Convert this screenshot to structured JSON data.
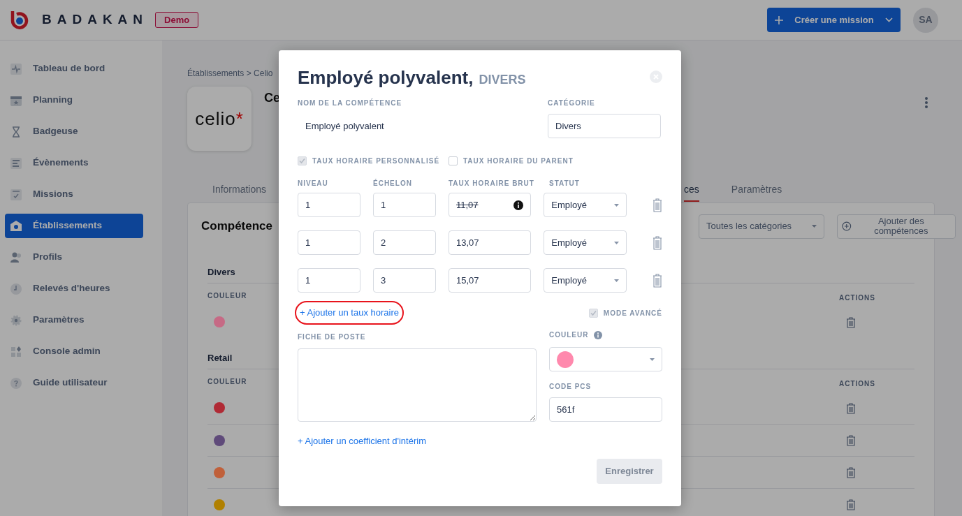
{
  "header": {
    "brand": "BADAKAN",
    "badge": "Demo",
    "create_button": "Créer une mission",
    "avatar": "SA"
  },
  "sidebar": {
    "items": [
      {
        "label": "Tableau de bord",
        "selected": false
      },
      {
        "label": "Planning",
        "selected": false
      },
      {
        "label": "Badgeuse",
        "selected": false
      },
      {
        "label": "Évènements",
        "selected": false
      },
      {
        "label": "Missions",
        "selected": false
      },
      {
        "label": "Établissements",
        "selected": true
      },
      {
        "label": "Profils",
        "selected": false
      },
      {
        "label": "Relevés d'heures",
        "selected": false
      },
      {
        "label": "Paramètres",
        "selected": false
      },
      {
        "label": "Console admin",
        "selected": false
      },
      {
        "label": "Guide utilisateur",
        "selected": false
      }
    ]
  },
  "page": {
    "breadcrumb": "Établissements > Celio",
    "logo": {
      "text": "celio",
      "mark": "*"
    },
    "title": "Ce",
    "tabs": [
      {
        "label": "Informations",
        "selected": false
      },
      {
        "label": "ces",
        "selected": true
      },
      {
        "label": "Paramètres",
        "selected": false
      }
    ],
    "card": {
      "title": "Compétence",
      "filter": "Toutes les catégories",
      "add_button": "Ajouter des compétences",
      "groups": [
        {
          "name": "Divers",
          "color_header": "COULEUR",
          "actions_header": "ACTIONS",
          "rows": [
            {
              "color": "#c66a85"
            }
          ]
        },
        {
          "name": "Retail",
          "color_header": "COULEUR",
          "actions_header": "ACTIONS",
          "rows": [
            {
              "color": "#b02a35"
            },
            {
              "color": "#5f4a7a"
            },
            {
              "color": "#c0603a"
            },
            {
              "color": "#b08000"
            }
          ]
        }
      ]
    }
  },
  "modal": {
    "title": "Employé polyvalent,",
    "subtitle": "DIVERS",
    "name_label": "NOM DE LA COMPÉTENCE",
    "name_value": "Employé polyvalent",
    "category_label": "CATÉGORIE",
    "category_value": "Divers",
    "checks": [
      {
        "label": "TAUX HORAIRE PERSONNALISÉ",
        "checked": true,
        "disabled": true
      },
      {
        "label": "TAUX HORAIRE DU PARENT",
        "checked": false,
        "disabled": false
      }
    ],
    "rate_columns": [
      "NIVEAU",
      "ÉCHELON",
      "TAUX HORAIRE BRUT",
      "STATUT"
    ],
    "rates": [
      {
        "niveau": "1",
        "echelon": "1",
        "taux": "11,07",
        "struck": true,
        "statut": "Employé"
      },
      {
        "niveau": "1",
        "echelon": "2",
        "taux": "13,07",
        "struck": false,
        "statut": "Employé"
      },
      {
        "niveau": "1",
        "echelon": "3",
        "taux": "15,07",
        "struck": false,
        "statut": "Employé"
      }
    ],
    "add_rate_link": "+ Ajouter un taux horaire",
    "add_rate_highlighted": true,
    "advanced": {
      "label": "MODE AVANCÉ",
      "checked": true
    },
    "job_label": "FICHE DE POSTE",
    "color_label": "COULEUR",
    "color": "#ff89ad",
    "pcs_label": "CODE PCS",
    "pcs_value": "561f",
    "add_coef_link": "+ Ajouter un coefficient d'intérim",
    "save_button": "Enregistrer",
    "save_disabled": true
  }
}
